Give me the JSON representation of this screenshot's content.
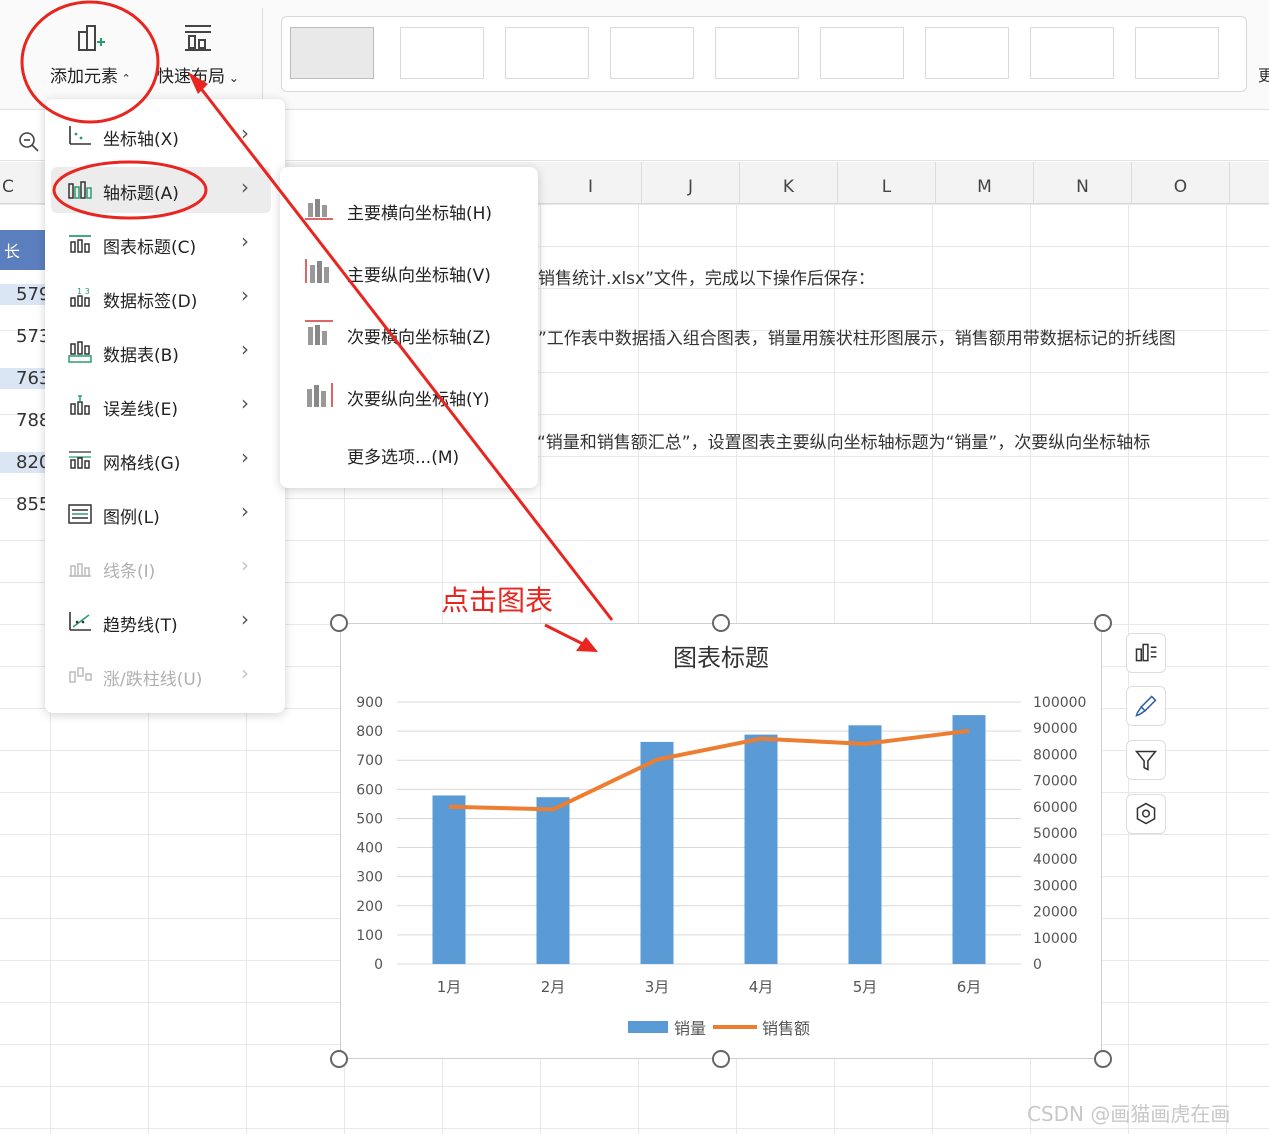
{
  "ribbon": {
    "add_element_label": "添加元素",
    "quick_layout_label": "快速布局",
    "tail_char": "更"
  },
  "sheet": {
    "columns": [
      "C",
      "I",
      "J",
      "K",
      "L",
      "M",
      "N",
      "O"
    ],
    "col_c_values": [
      "579",
      "573",
      "763",
      "788",
      "820",
      "855"
    ],
    "text_lines": [
      "销售统计.xlsx”文件，完成以下操作后保存：",
      "”工作表中数据插入组合图表，销量用簇状柱形图展示，销售额用带数据标记的折线图",
      "为“销量和销售额汇总”，设置图表主要纵向坐标轴标题为“销量”，次要纵向坐标轴标"
    ]
  },
  "menu": {
    "items": [
      {
        "label": "坐标轴(X)",
        "icon": "axis-icon",
        "enabled": true
      },
      {
        "label": "轴标题(A)",
        "icon": "axis-title-icon",
        "enabled": true
      },
      {
        "label": "图表标题(C)",
        "icon": "chart-title-icon",
        "enabled": true
      },
      {
        "label": "数据标签(D)",
        "icon": "data-labels-icon",
        "enabled": true
      },
      {
        "label": "数据表(B)",
        "icon": "data-table-icon",
        "enabled": true
      },
      {
        "label": "误差线(E)",
        "icon": "error-bars-icon",
        "enabled": true
      },
      {
        "label": "网格线(G)",
        "icon": "gridlines-icon",
        "enabled": true
      },
      {
        "label": "图例(L)",
        "icon": "legend-icon",
        "enabled": true
      },
      {
        "label": "线条(I)",
        "icon": "lines-icon",
        "enabled": false
      },
      {
        "label": "趋势线(T)",
        "icon": "trendline-icon",
        "enabled": true
      },
      {
        "label": "涨/跌柱线(U)",
        "icon": "up-down-bars-icon",
        "enabled": false
      }
    ],
    "hover_index": 1
  },
  "submenu": {
    "items": [
      {
        "label": "主要横向坐标轴(H)",
        "icon": "primary-horizontal-axis-icon"
      },
      {
        "label": "主要纵向坐标轴(V)",
        "icon": "primary-vertical-axis-icon"
      },
      {
        "label": "次要横向坐标轴(Z)",
        "icon": "secondary-horizontal-axis-icon"
      },
      {
        "label": "次要纵向坐标轴(Y)",
        "icon": "secondary-vertical-axis-icon"
      },
      {
        "label": "更多选项...(M)",
        "icon": ""
      }
    ]
  },
  "annotation": {
    "text": "点击图表",
    "color": "#e8251f"
  },
  "watermark": "CSDN @画猫画虎在画",
  "colors": {
    "bar": "#5b9bd5",
    "line": "#ed7d31",
    "annotation": "#e8251f"
  },
  "chart_data": {
    "type": "bar",
    "title": "图表标题",
    "categories": [
      "1月",
      "2月",
      "3月",
      "4月",
      "5月",
      "6月"
    ],
    "series": [
      {
        "name": "销量",
        "type": "bar",
        "axis": "primary",
        "values": [
          579,
          573,
          763,
          788,
          820,
          855
        ]
      },
      {
        "name": "销售额",
        "type": "line",
        "axis": "secondary",
        "values": [
          60000,
          59000,
          78000,
          86000,
          84000,
          89000
        ]
      }
    ],
    "ylim": [
      0,
      900
    ],
    "y_ticks": [
      "900",
      "800",
      "700",
      "600",
      "500",
      "400",
      "300",
      "200",
      "100",
      "0"
    ],
    "y2lim": [
      0,
      100000
    ],
    "y2_ticks": [
      "100000",
      "90000",
      "80000",
      "70000",
      "60000",
      "50000",
      "40000",
      "30000",
      "20000",
      "10000",
      "0"
    ],
    "grid": true,
    "legend": "bottom"
  }
}
